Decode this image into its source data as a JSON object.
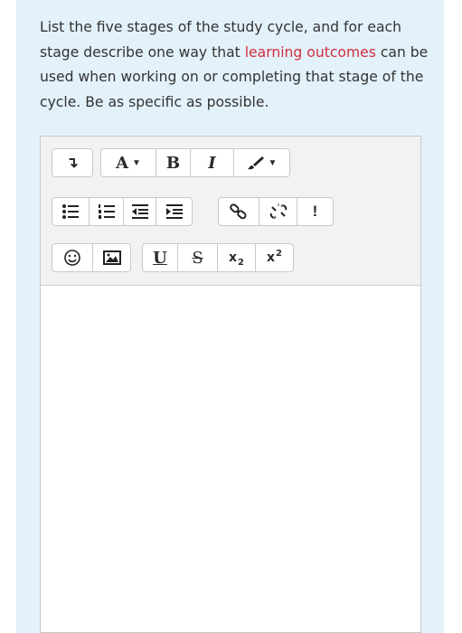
{
  "question": {
    "part1": "List the five stages of the study cycle, and for each stage describe one way that ",
    "highlight": "learning outcomes",
    "part2": " can be used when working on or completing that stage of the cycle. Be as specific as possible."
  },
  "toolbar": {
    "row1": [
      {
        "name": "show-more-icon",
        "glyph": "↴"
      },
      {
        "name": "font-size-button",
        "label": "A"
      },
      {
        "name": "bold-button",
        "label": "B"
      },
      {
        "name": "italic-button",
        "label": "I"
      },
      {
        "name": "text-color-button",
        "icon": "brush-icon"
      }
    ],
    "row2": [
      {
        "name": "unordered-list-button",
        "icon": "bullet-list-icon"
      },
      {
        "name": "ordered-list-button",
        "icon": "numbered-list-icon"
      },
      {
        "name": "outdent-button",
        "icon": "outdent-icon"
      },
      {
        "name": "indent-button",
        "icon": "indent-icon"
      },
      {
        "name": "link-button",
        "icon": "link-icon"
      },
      {
        "name": "unlink-button",
        "icon": "unlink-icon"
      },
      {
        "name": "nolink-button",
        "label": "!"
      }
    ],
    "row3": [
      {
        "name": "emoticon-button",
        "icon": "smiley-icon"
      },
      {
        "name": "image-button",
        "icon": "image-icon"
      },
      {
        "name": "underline-button",
        "label": "U"
      },
      {
        "name": "strikethrough-button",
        "label": "S"
      },
      {
        "name": "subscript-button",
        "label": "x",
        "small": "2"
      },
      {
        "name": "superscript-button",
        "label": "x",
        "small": "2"
      }
    ]
  },
  "editor": {
    "content": ""
  }
}
